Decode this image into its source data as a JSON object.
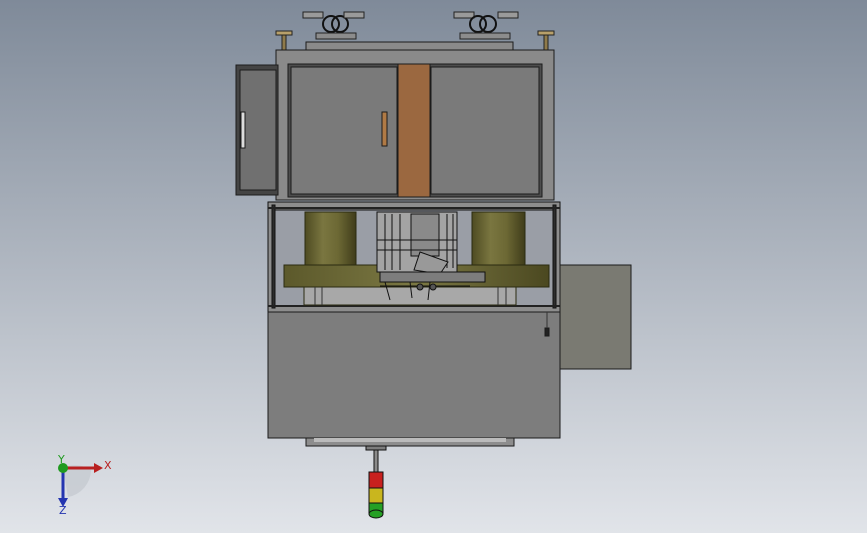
{
  "viewport": {
    "background_top": "#7f8a99",
    "background_bottom": "#e1e4e9"
  },
  "triad": {
    "x_label": "X",
    "y_label": "Y",
    "z_label": "Z",
    "x_color": "#b82020",
    "y_color": "#1f9a1f",
    "z_color": "#2435b0"
  },
  "colors": {
    "wood_panel": "#9b6840",
    "olive_cylinder": "#6e6a35",
    "cabinet_gray": "#6e6e6e",
    "door_gray": "#7a7a7a",
    "light_red": "#c8201e",
    "light_yellow": "#c9b61e",
    "light_green": "#25a025"
  }
}
